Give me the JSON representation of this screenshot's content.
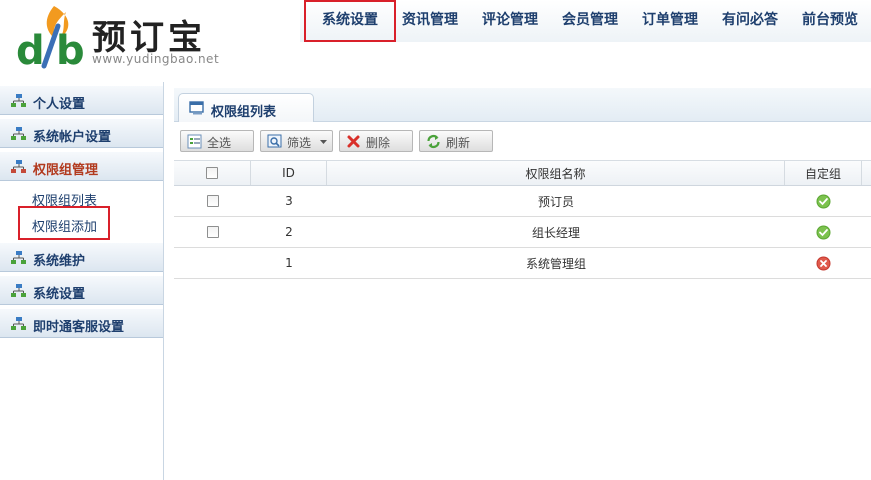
{
  "header": {
    "logo_text": "预订宝",
    "logo_url": "www.yudingbao.net",
    "nav": [
      {
        "label": "系统设置",
        "active": true
      },
      {
        "label": "资讯管理",
        "active": false
      },
      {
        "label": "评论管理",
        "active": false
      },
      {
        "label": "会员管理",
        "active": false
      },
      {
        "label": "订单管理",
        "active": false
      },
      {
        "label": "有问必答",
        "active": false
      },
      {
        "label": "前台预览",
        "active": false
      }
    ]
  },
  "sidebar": {
    "sections": [
      {
        "label": "个人设置"
      },
      {
        "label": "系统帐户设置"
      },
      {
        "label": "权限组管理"
      },
      {
        "label": "系统维护"
      },
      {
        "label": "系统设置"
      },
      {
        "label": "即时通客服设置"
      }
    ],
    "subitems": [
      {
        "label": "权限组列表"
      },
      {
        "label": "权限组添加"
      }
    ]
  },
  "main": {
    "tab_label": "权限组列表",
    "toolbar": {
      "select_all": "全选",
      "filter": "筛选",
      "delete": "删除",
      "refresh": "刷新"
    },
    "table": {
      "headers": {
        "id": "ID",
        "name": "权限组名称",
        "custom": "自定组"
      },
      "rows": [
        {
          "id": "3",
          "name": "预订员",
          "custom": true
        },
        {
          "id": "2",
          "name": "组长经理",
          "custom": true
        },
        {
          "id": "1",
          "name": "系统管理组",
          "custom": false
        }
      ]
    }
  },
  "colors": {
    "accent_red": "#d9202a",
    "nav_blue": "#1e3f6e",
    "ok_green": "#5aa632",
    "no_red": "#d9453a"
  }
}
